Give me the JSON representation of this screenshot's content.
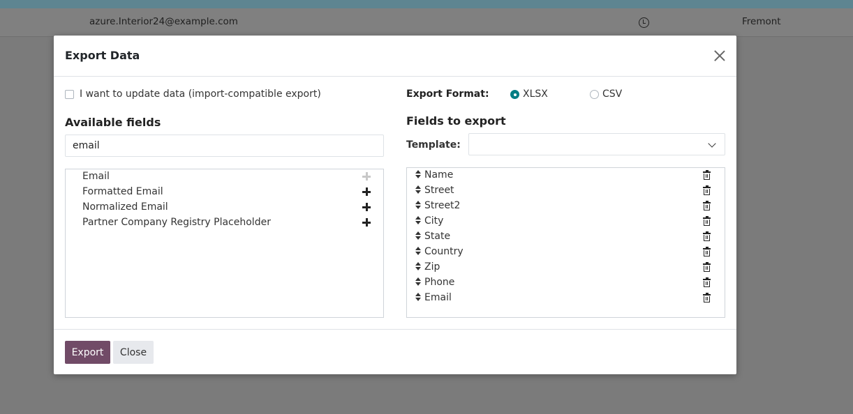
{
  "background": {
    "row_email": "azure.Interior24@example.com",
    "row_city": "Fremont"
  },
  "dialog": {
    "title": "Export Data",
    "import_compat_label": "I want to update data (import-compatible export)",
    "import_compat_checked": false,
    "available_fields_heading": "Available fields",
    "search_value": "email",
    "available_fields": [
      {
        "label": "Email",
        "added": true
      },
      {
        "label": "Formatted Email",
        "added": false
      },
      {
        "label": "Normalized Email",
        "added": false
      },
      {
        "label": "Partner Company Registry Placeholder",
        "added": false
      }
    ],
    "export_format_label": "Export Format:",
    "formats": [
      {
        "label": "XLSX",
        "selected": true
      },
      {
        "label": "CSV",
        "selected": false
      }
    ],
    "fields_to_export_heading": "Fields to export",
    "template_label": "Template:",
    "template_value": "",
    "export_fields": [
      "Name",
      "Street",
      "Street2",
      "City",
      "State",
      "Country",
      "Zip",
      "Phone",
      "Email"
    ],
    "export_button": "Export",
    "close_button": "Close"
  },
  "colors": {
    "primary": "#714b67",
    "radio_accent": "#017e84",
    "overlay_bg": "#7b7b7b"
  },
  "icons": {
    "close": "close-icon",
    "add": "plus-icon",
    "sort": "sort-icon",
    "remove": "trash-icon",
    "dropdown": "chevron-down-icon",
    "clock": "clock-icon"
  }
}
